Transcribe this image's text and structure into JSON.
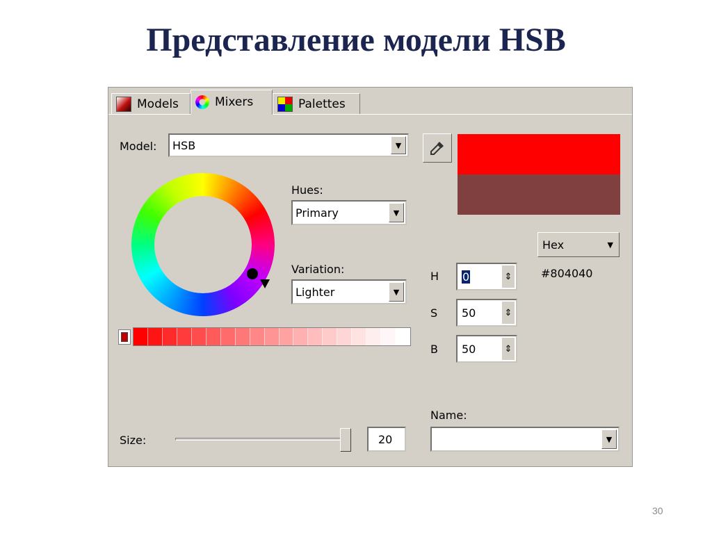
{
  "slide": {
    "title": "Представление модели HSB",
    "number": "30"
  },
  "tabs": [
    {
      "label": "Models",
      "icon": "models-icon"
    },
    {
      "label": "Mixers",
      "icon": "mixers-icon"
    },
    {
      "label": "Palettes",
      "icon": "palettes-icon"
    }
  ],
  "model": {
    "label": "Model:",
    "value": "HSB"
  },
  "hues": {
    "label": "Hues:",
    "value": "Primary"
  },
  "variation": {
    "label": "Variation:",
    "value": "Lighter"
  },
  "preview": {
    "new_color": "#ff0000",
    "old_color": "#804040"
  },
  "format": {
    "value": "Hex"
  },
  "hex_value": "#804040",
  "hsb": {
    "h": {
      "label": "H",
      "value": "0"
    },
    "s": {
      "label": "S",
      "value": "50"
    },
    "b": {
      "label": "B",
      "value": "50"
    }
  },
  "name": {
    "label": "Name:",
    "value": ""
  },
  "size": {
    "label": "Size:",
    "value": "20"
  },
  "strip_colors": [
    "#ff0000",
    "#ff1414",
    "#ff2a2a",
    "#ff3b3b",
    "#ff4c4c",
    "#ff5b5b",
    "#ff6a6a",
    "#ff7878",
    "#ff8787",
    "#ff9494",
    "#ffa2a2",
    "#ffb0b0",
    "#ffbdbd",
    "#ffcaca",
    "#ffd6d6",
    "#ffe2e2",
    "#ffeeee",
    "#fff7f7",
    "#ffffff"
  ]
}
